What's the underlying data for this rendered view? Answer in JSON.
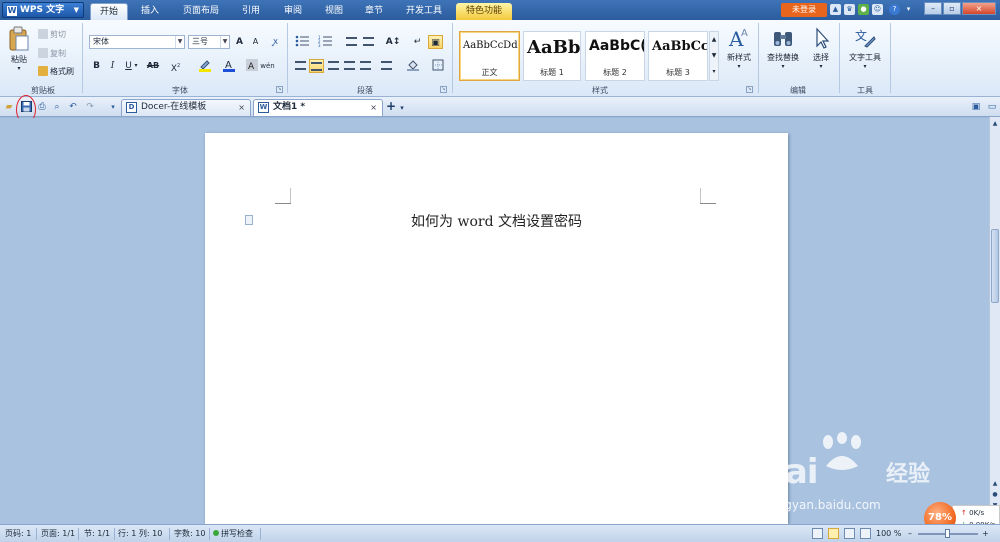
{
  "app": {
    "name": "WPS 文字"
  },
  "menu": {
    "tabs": [
      "开始",
      "插入",
      "页面布局",
      "引用",
      "审阅",
      "视图",
      "章节",
      "开发工具",
      "特色功能"
    ],
    "active": "开始",
    "login": "未登录"
  },
  "window_controls": {
    "minimize": "–",
    "restore": "▫",
    "close": "×"
  },
  "clipboard": {
    "paste": "粘贴",
    "cut": "剪切",
    "copy": "复制",
    "format_painter": "格式刷",
    "label": "剪贴板"
  },
  "font": {
    "name": "宋体",
    "size": "三号",
    "grow": "A",
    "shrink": "A",
    "bold": "B",
    "italic": "I",
    "underline": "U",
    "strikethrough": "AB",
    "superscript": "X",
    "label": "字体"
  },
  "paragraph": {
    "label": "段落"
  },
  "styles": {
    "items": [
      {
        "sample": "AaBbCcDd",
        "name": "正文"
      },
      {
        "sample": "AaBb(",
        "name": "标题 1"
      },
      {
        "sample": "AaBbC(",
        "name": "标题 2"
      },
      {
        "sample": "AaBbCc",
        "name": "标题 3"
      }
    ],
    "selected_index": 0,
    "new_style": "新样式",
    "label": "样式"
  },
  "editing": {
    "find_replace": "查找替换",
    "select": "选择",
    "label": "编辑"
  },
  "tools": {
    "text_tools": "文字工具",
    "label": "工具"
  },
  "doc_tabs": [
    {
      "title": "Docer-在线模板",
      "active": false
    },
    {
      "title": "文档1 *",
      "active": true
    }
  ],
  "document": {
    "title": "如何为 word 文档设置密码"
  },
  "watermark": {
    "brand": "Bai",
    "brand_suffix": "经验",
    "url": "jingyan.baidu.com"
  },
  "speed": {
    "percent": "78%",
    "up": "0K/s",
    "down": "0.09K/s"
  },
  "status": {
    "page": "页码: 1",
    "pages": "页面: 1/1",
    "section": "节: 1/1",
    "line_col": "行: 1  列: 10",
    "words": "字数: 10",
    "spell": "拼写检查",
    "zoom": "100 %",
    "zoom_level": 0.5
  },
  "colors": {
    "accent": "#2b5c9e",
    "login": "#e8651e",
    "highlight_ring": "#e0202a",
    "font_color": "#1c4fd6",
    "highlight_color": "#f5e600"
  }
}
